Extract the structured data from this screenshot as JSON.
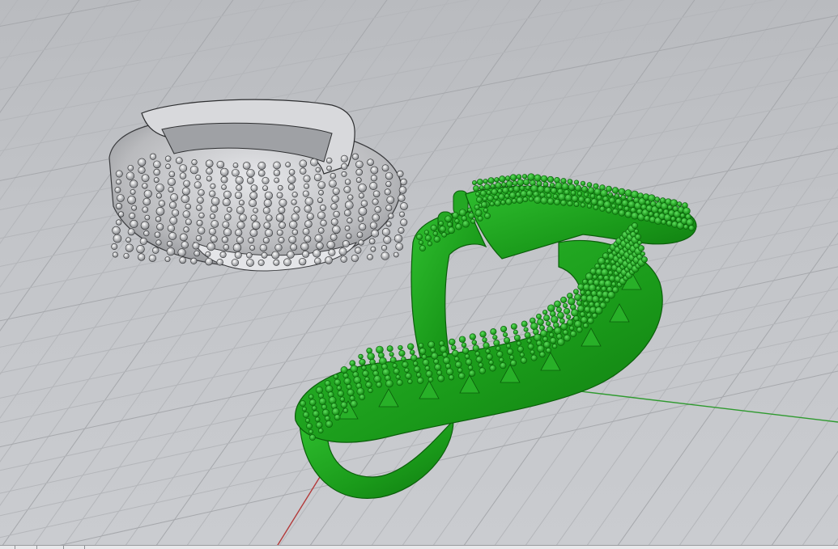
{
  "viewport": {
    "name": "Perspective",
    "colors": {
      "background": "#c3c5c9",
      "grid_minor": "#b4b6ba",
      "grid_major": "#a6a8ac",
      "x_axis": "#b33a3a",
      "y_axis": "#2f9a2f",
      "gray_model": "#c9cacd",
      "green_model": "#1f9a1f"
    }
  },
  "objects": [
    {
      "name": "gray-domed-ring",
      "type": "pave ring",
      "color": "gray",
      "selected": false
    },
    {
      "name": "green-infinity-ring",
      "type": "pave ring",
      "color": "green",
      "selected": true
    }
  ]
}
